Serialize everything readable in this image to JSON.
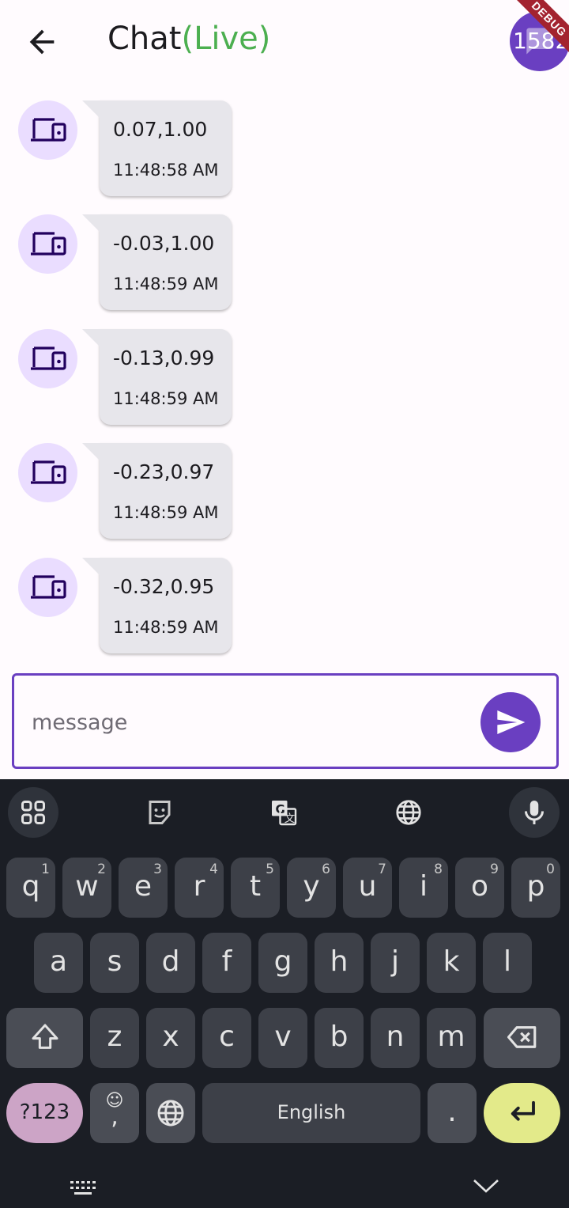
{
  "header": {
    "title": "Chat",
    "live": "(Live)",
    "counter": "1582",
    "debug_banner": "DEBUG"
  },
  "messages": [
    {
      "value": "0.07,1.00",
      "time": "11:48:58 AM"
    },
    {
      "value": "-0.03,1.00",
      "time": "11:48:59 AM"
    },
    {
      "value": "-0.13,0.99",
      "time": "11:48:59 AM"
    },
    {
      "value": "-0.23,0.97",
      "time": "11:48:59 AM"
    },
    {
      "value": "-0.32,0.95",
      "time": "11:48:59 AM"
    }
  ],
  "input": {
    "placeholder": "message",
    "value": ""
  },
  "keyboard": {
    "row1": [
      {
        "k": "q",
        "n": "1"
      },
      {
        "k": "w",
        "n": "2"
      },
      {
        "k": "e",
        "n": "3"
      },
      {
        "k": "r",
        "n": "4"
      },
      {
        "k": "t",
        "n": "5"
      },
      {
        "k": "y",
        "n": "6"
      },
      {
        "k": "u",
        "n": "7"
      },
      {
        "k": "i",
        "n": "8"
      },
      {
        "k": "o",
        "n": "9"
      },
      {
        "k": "p",
        "n": "0"
      }
    ],
    "row2": [
      "a",
      "s",
      "d",
      "f",
      "g",
      "h",
      "j",
      "k",
      "l"
    ],
    "row3": [
      "z",
      "x",
      "c",
      "v",
      "b",
      "n",
      "m"
    ],
    "num_key": "?123",
    "comma_key": ",",
    "space_label": "English",
    "period_key": "."
  },
  "colors": {
    "accent": "#6a3fc1",
    "live": "#4caf50",
    "bubble": "#e7e6eb",
    "avatar": "#eaddff",
    "keyboard_bg": "#1b1e25"
  }
}
